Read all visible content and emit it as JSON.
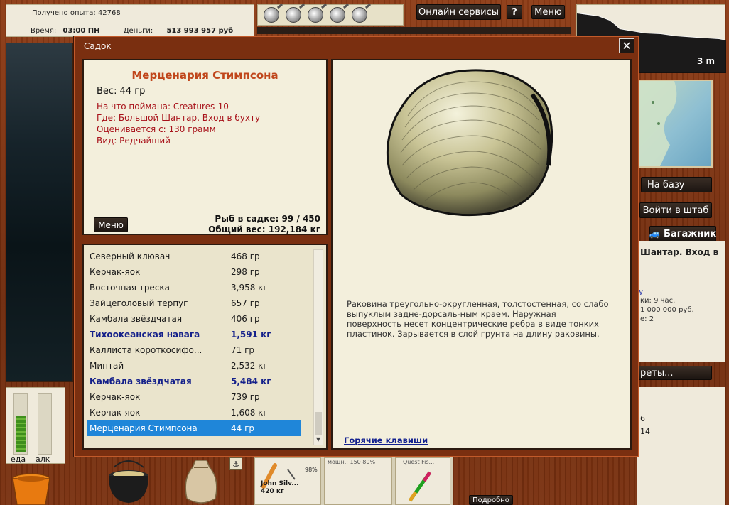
{
  "hud": {
    "experience": "Получено опыта: 42768",
    "time_label": "Время:",
    "time_value": "03:00 ПН",
    "money_label": "Деньги:",
    "money_value": "513 993 957 руб",
    "online_services": "Онлайн сервисы",
    "help": "?",
    "menu": "Меню",
    "depth": "3 m"
  },
  "right_side": {
    "to_base": "На базу",
    "enter_hq": "Войти в штаб",
    "trunk": "Багажник",
    "location_frag_1": "Шантар. Вход в",
    "location_frag_2": "",
    "link_frag": "евку",
    "line_1": "ки: 9 час.",
    "line_2": "1 000 000 руб.",
    "line_3": "е: 2",
    "secrets": "реты...",
    "num_1": "6",
    "num_2": "14"
  },
  "gauges": {
    "food_label": "еда",
    "alc_label": "алк",
    "food_level": 0.62,
    "alc_level": 0.0
  },
  "bottom": {
    "card1_name": "John Silv...",
    "card1_weight": "420 кг",
    "card1_pct": "98%",
    "card2_tiny": "мощн.: 150     80%",
    "card3_tiny": "Quest Fis...",
    "details": "Подробно"
  },
  "window": {
    "title": "Садок",
    "close": "✕",
    "fish": {
      "name": "Мерценария Стимпсона",
      "weight": "Вес: 44 гр",
      "caught_on": "На что поймана: Creatures-10",
      "where": "Где: Большой Шантар, Вход в бухту",
      "rated_from": "Оценивается с: 130 грамм",
      "kind": "Вид: Редчайший"
    },
    "menu_button": "Меню",
    "fish_count": "Рыб в садке: 99 / 450",
    "total_weight": "Общий вес: 192,184 кг",
    "list": [
      {
        "name": "Северный клювач",
        "weight": "468 гр",
        "rare": false,
        "selected": false
      },
      {
        "name": "Керчак-яок",
        "weight": "298 гр",
        "rare": false,
        "selected": false
      },
      {
        "name": "Восточная треска",
        "weight": "3,958 кг",
        "rare": false,
        "selected": false
      },
      {
        "name": "Зайцеголовый терпуг",
        "weight": "657 гр",
        "rare": false,
        "selected": false
      },
      {
        "name": "Камбала звёздчатая",
        "weight": "406 гр",
        "rare": false,
        "selected": false
      },
      {
        "name": "Тихоокеанская навага",
        "weight": "1,591 кг",
        "rare": true,
        "selected": false
      },
      {
        "name": "Каллиста короткосифо...",
        "weight": "71 гр",
        "rare": false,
        "selected": false
      },
      {
        "name": "Минтай",
        "weight": "2,532 кг",
        "rare": false,
        "selected": false
      },
      {
        "name": "Камбала звёздчатая",
        "weight": "5,484 кг",
        "rare": true,
        "selected": false
      },
      {
        "name": "Керчак-яок",
        "weight": "739 гр",
        "rare": false,
        "selected": false
      },
      {
        "name": "Керчак-яок",
        "weight": "1,608 кг",
        "rare": false,
        "selected": false
      },
      {
        "name": "Мерценария Стимпсона",
        "weight": "44 гр",
        "rare": false,
        "selected": true
      }
    ],
    "description": "Раковина треугольно-округленная, толстостенная, со слабо выпуклым задне-дорсаль-ным краем. Наружная поверхность несет концентрические ребра в виде тонких пластинок. Зарывается в слой грунта на длину раковины.",
    "hotkeys": "Горячие клавиши"
  },
  "colors": {
    "fish_name": "#c0461b",
    "attr_red": "#a8121a",
    "rare_blue": "#14208a",
    "selection": "#1f86d9",
    "wood": "#8a3814",
    "cream": "#f3efdc"
  }
}
